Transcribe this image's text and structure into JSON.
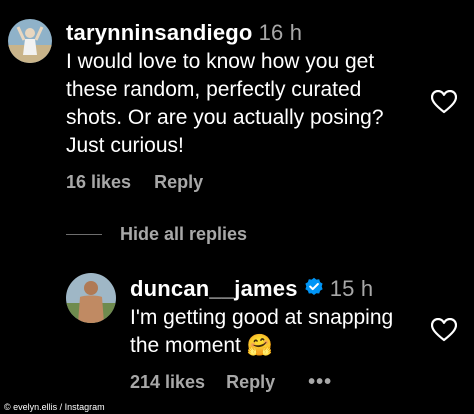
{
  "comment": {
    "username": "tarynninsandiego",
    "time": "16 h",
    "text_lines": [
      "I would love to know how you get",
      "these random, perfectly curated",
      "shots. Or are you actually posing?",
      "Just curious!"
    ],
    "likes": "16 likes",
    "reply_label": "Reply"
  },
  "replies_toggle": "Hide all replies",
  "reply": {
    "username": "duncan__james",
    "time": "15 h",
    "text_line1": "I'm getting good at snapping",
    "text_line2": "the moment",
    "emoji": "🤗",
    "likes": "214 likes",
    "reply_label": "Reply",
    "more": "•••"
  },
  "credit": "© evelyn.ellis / Instagram",
  "colors": {
    "background": "#000000",
    "secondary_text": "#a8a8a8",
    "verified": "#0095f6"
  },
  "icons": [
    "heart-icon",
    "verified-badge-icon",
    "more-options-icon"
  ]
}
